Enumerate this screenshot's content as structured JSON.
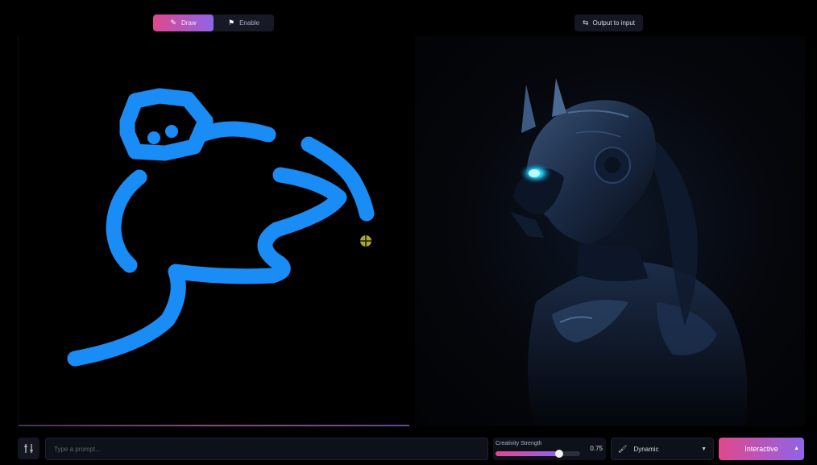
{
  "modes": {
    "active": {
      "label": "Draw",
      "icon": "pen-icon"
    },
    "inactive": {
      "label": "Enable",
      "icon": "flag-icon"
    }
  },
  "output_to_input": {
    "label": "Output to input",
    "icon": "swap-arrows-icon"
  },
  "prompt": {
    "value": "",
    "placeholder": "Type a prompt..."
  },
  "creativity": {
    "label": "Creativity Strength",
    "value": "0.75",
    "fraction": 0.75
  },
  "style": {
    "label": "Dynamic",
    "icon": "brush-icon"
  },
  "generate": {
    "label": "Interactive"
  },
  "settings": {
    "icon": "sliders-icon"
  },
  "colors": {
    "stroke": "#1a8cf5",
    "accent_start": "#e0488d",
    "accent_end": "#8f64e8",
    "cursor": "#c9c43a"
  }
}
